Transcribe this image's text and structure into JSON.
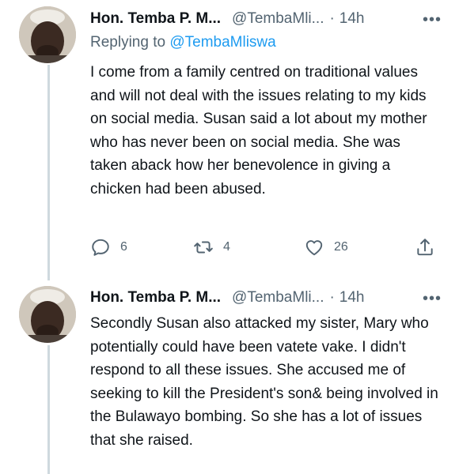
{
  "tweets": [
    {
      "author_name": "Hon. Temba P. M...",
      "handle": "@TembaMli...",
      "separator": "·",
      "time": "14h",
      "more": "•••",
      "reply_prefix": "Replying to",
      "reply_handle": "@TembaMliswa",
      "text": "I come from a family centred on traditional values and will not deal with the issues relating to my kids on social media. Susan said a lot about my mother who has never been on social media. She was taken aback how her benevolence in giving a chicken had been abused.",
      "stats": {
        "replies": "6",
        "retweets": "4",
        "likes": "26"
      }
    },
    {
      "author_name": "Hon. Temba P. M...",
      "handle": "@TembaMli...",
      "separator": "·",
      "time": "14h",
      "more": "•••",
      "text": "Secondly Susan also attacked my sister, Mary who potentially could have been vatete vake. I didn't respond to all these issues. She accused me of seeking to kill the President's son& being involved in the Bulawayo bombing. So she has a lot of issues that she raised."
    }
  ],
  "icons": {
    "reply": "reply-icon",
    "retweet": "retweet-icon",
    "like": "heart-icon",
    "share": "share-icon",
    "more": "more-icon"
  },
  "colors": {
    "link": "#1d9bf0",
    "secondary_text": "#536471",
    "primary_text": "#0f1419",
    "thread_line": "#cfd9de"
  }
}
